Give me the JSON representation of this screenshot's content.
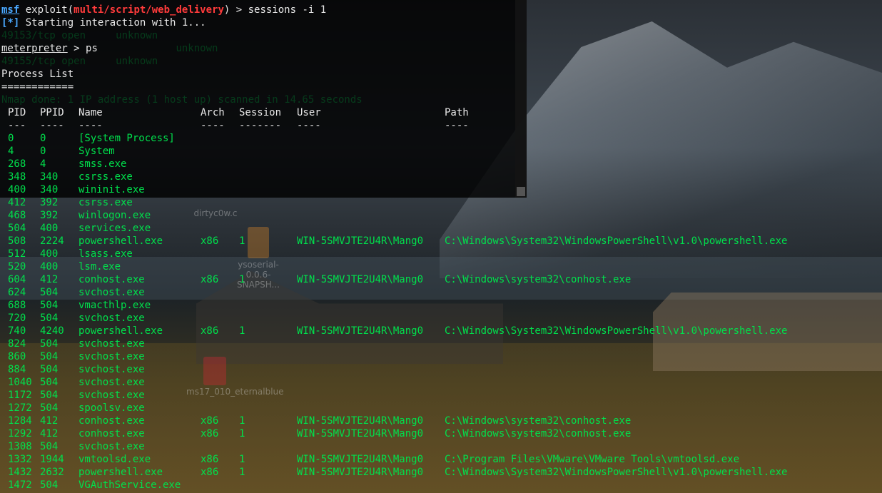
{
  "prompt": {
    "msf": "msf",
    "exploit_prefix": " exploit(",
    "module": "multi/script/web_delivery",
    "exploit_suffix": ") > ",
    "command": "sessions -i 1",
    "star": "[*]",
    "starting": " Starting interaction with 1...",
    "meterpreter": "meterpreter",
    "mp_sep": " > ",
    "mp_command": "ps"
  },
  "ghost_lines": [
    "49153/tcp open     unknown",
    "                   unknown",
    "49155/tcp open     unknown",
    "Nmap done: 1 IP address (1 host up) scanned in 14.65 seconds"
  ],
  "process_list": {
    "title": "Process List",
    "underline": "============",
    "headers": {
      "pid": "PID",
      "ppid": "PPID",
      "name": "Name",
      "arch": "Arch",
      "session": "Session",
      "user": "User",
      "path": "Path"
    },
    "separators": {
      "pid": "---",
      "ppid": "----",
      "name": "----",
      "arch": "----",
      "session": "-------",
      "user": "----",
      "path": "----"
    },
    "rows": [
      {
        "pid": "0",
        "ppid": "0",
        "name": "[System Process]",
        "arch": "",
        "session": "",
        "user": "",
        "path": ""
      },
      {
        "pid": "4",
        "ppid": "0",
        "name": "System",
        "arch": "",
        "session": "",
        "user": "",
        "path": ""
      },
      {
        "pid": "268",
        "ppid": "4",
        "name": "smss.exe",
        "arch": "",
        "session": "",
        "user": "",
        "path": ""
      },
      {
        "pid": "348",
        "ppid": "340",
        "name": "csrss.exe",
        "arch": "",
        "session": "",
        "user": "",
        "path": ""
      },
      {
        "pid": "400",
        "ppid": "340",
        "name": "wininit.exe",
        "arch": "",
        "session": "",
        "user": "",
        "path": ""
      },
      {
        "pid": "412",
        "ppid": "392",
        "name": "csrss.exe",
        "arch": "",
        "session": "",
        "user": "",
        "path": ""
      },
      {
        "pid": "468",
        "ppid": "392",
        "name": "winlogon.exe",
        "arch": "",
        "session": "",
        "user": "",
        "path": ""
      },
      {
        "pid": "504",
        "ppid": "400",
        "name": "services.exe",
        "arch": "",
        "session": "",
        "user": "",
        "path": ""
      },
      {
        "pid": "508",
        "ppid": "2224",
        "name": "powershell.exe",
        "arch": "x86",
        "session": "1",
        "user": "WIN-5SMVJTE2U4R\\Mang0",
        "path": "C:\\Windows\\System32\\WindowsPowerShell\\v1.0\\powershell.exe"
      },
      {
        "pid": "512",
        "ppid": "400",
        "name": "lsass.exe",
        "arch": "",
        "session": "",
        "user": "",
        "path": ""
      },
      {
        "pid": "520",
        "ppid": "400",
        "name": "lsm.exe",
        "arch": "",
        "session": "",
        "user": "",
        "path": ""
      },
      {
        "pid": "604",
        "ppid": "412",
        "name": "conhost.exe",
        "arch": "x86",
        "session": "1",
        "user": "WIN-5SMVJTE2U4R\\Mang0",
        "path": "C:\\Windows\\system32\\conhost.exe"
      },
      {
        "pid": "624",
        "ppid": "504",
        "name": "svchost.exe",
        "arch": "",
        "session": "",
        "user": "",
        "path": ""
      },
      {
        "pid": "688",
        "ppid": "504",
        "name": "vmacthlp.exe",
        "arch": "",
        "session": "",
        "user": "",
        "path": ""
      },
      {
        "pid": "720",
        "ppid": "504",
        "name": "svchost.exe",
        "arch": "",
        "session": "",
        "user": "",
        "path": ""
      },
      {
        "pid": "740",
        "ppid": "4240",
        "name": "powershell.exe",
        "arch": "x86",
        "session": "1",
        "user": "WIN-5SMVJTE2U4R\\Mang0",
        "path": "C:\\Windows\\System32\\WindowsPowerShell\\v1.0\\powershell.exe"
      },
      {
        "pid": "824",
        "ppid": "504",
        "name": "svchost.exe",
        "arch": "",
        "session": "",
        "user": "",
        "path": ""
      },
      {
        "pid": "860",
        "ppid": "504",
        "name": "svchost.exe",
        "arch": "",
        "session": "",
        "user": "",
        "path": ""
      },
      {
        "pid": "884",
        "ppid": "504",
        "name": "svchost.exe",
        "arch": "",
        "session": "",
        "user": "",
        "path": ""
      },
      {
        "pid": "1040",
        "ppid": "504",
        "name": "svchost.exe",
        "arch": "",
        "session": "",
        "user": "",
        "path": ""
      },
      {
        "pid": "1172",
        "ppid": "504",
        "name": "svchost.exe",
        "arch": "",
        "session": "",
        "user": "",
        "path": ""
      },
      {
        "pid": "1272",
        "ppid": "504",
        "name": "spoolsv.exe",
        "arch": "",
        "session": "",
        "user": "",
        "path": ""
      },
      {
        "pid": "1284",
        "ppid": "412",
        "name": "conhost.exe",
        "arch": "x86",
        "session": "1",
        "user": "WIN-5SMVJTE2U4R\\Mang0",
        "path": "C:\\Windows\\system32\\conhost.exe"
      },
      {
        "pid": "1292",
        "ppid": "412",
        "name": "conhost.exe",
        "arch": "x86",
        "session": "1",
        "user": "WIN-5SMVJTE2U4R\\Mang0",
        "path": "C:\\Windows\\system32\\conhost.exe"
      },
      {
        "pid": "1308",
        "ppid": "504",
        "name": "svchost.exe",
        "arch": "",
        "session": "",
        "user": "",
        "path": ""
      },
      {
        "pid": "1332",
        "ppid": "1944",
        "name": "vmtoolsd.exe",
        "arch": "x86",
        "session": "1",
        "user": "WIN-5SMVJTE2U4R\\Mang0",
        "path": "C:\\Program Files\\VMware\\VMware Tools\\vmtoolsd.exe"
      },
      {
        "pid": "1432",
        "ppid": "2632",
        "name": "powershell.exe",
        "arch": "x86",
        "session": "1",
        "user": "WIN-5SMVJTE2U4R\\Mang0",
        "path": "C:\\Windows\\System32\\WindowsPowerShell\\v1.0\\powershell.exe"
      },
      {
        "pid": "1472",
        "ppid": "504",
        "name": "VGAuthService.exe",
        "arch": "",
        "session": "",
        "user": "",
        "path": ""
      }
    ]
  },
  "desktop_icons": [
    {
      "label": "dirtyc0w.c"
    },
    {
      "label": "ysoserial-0.0.6-SNAPSH..."
    },
    {
      "label": "ms17_010_eternalblue"
    }
  ],
  "colors": {
    "terminal_green": "#00e04c",
    "module_red": "#ff3b3b",
    "prompt_blue": "#4aa8ff"
  }
}
